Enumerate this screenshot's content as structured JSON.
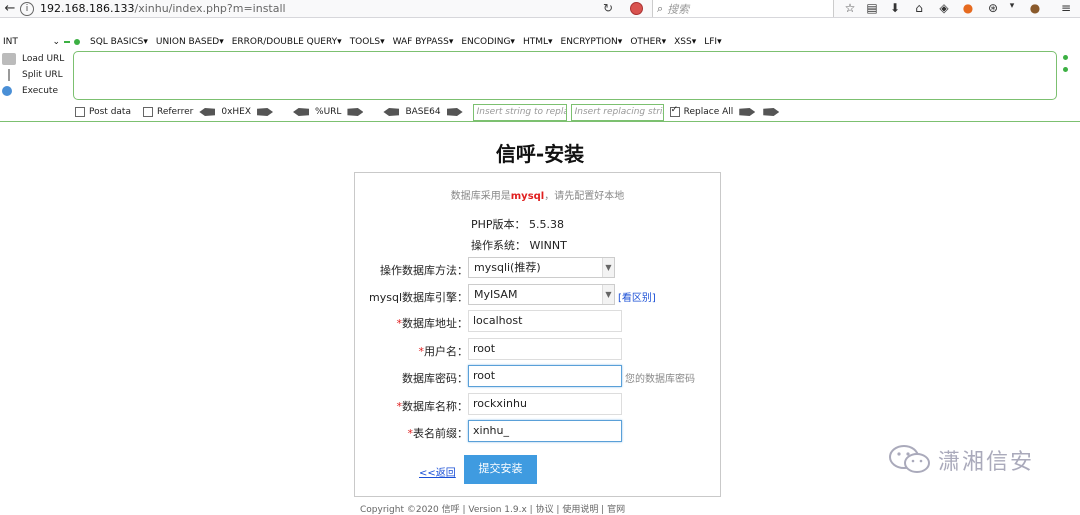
{
  "browser": {
    "url_host": "192.168.186.133",
    "url_path": "/xinhu/index.php?m=install",
    "search_placeholder": "搜索"
  },
  "hackbar": {
    "encoding_select": "INT",
    "menus": [
      "SQL BASICS▾",
      "UNION BASED▾",
      "ERROR/DOUBLE QUERY▾",
      "TOOLS▾",
      "WAF BYPASS▾",
      "ENCODING▾",
      "HTML▾",
      "ENCRYPTION▾",
      "OTHER▾",
      "XSS▾",
      "LFI▾"
    ],
    "load_url": "Load URL",
    "split_url": "Split URL",
    "execute": "Execute",
    "post_data": "Post data",
    "referrer": "Referrer",
    "hex": "0xHEX",
    "url_enc": "%URL",
    "base64": "BASE64",
    "insert_ph": "Insert string to replace",
    "replacing_ph": "Insert replacing string",
    "replace_all": "Replace All"
  },
  "page": {
    "title": "信呼-安装",
    "notice_pre": "数据库采用是",
    "notice_hl": "mysql",
    "notice_post": "，请先配置好本地",
    "php_version": "PHP版本：  5.5.38",
    "os": "操作系统：  WINNT",
    "db_method_label": "操作数据库方法：",
    "db_method_value": "mysqli(推荐)",
    "engine_label": "mysql数据库引擎：",
    "engine_value": "MyISAM",
    "engine_link": "[看区别]",
    "host_label": "数据库地址：",
    "host_value": "localhost",
    "user_label": "用户名：",
    "user_value": "root",
    "pass_label": "数据库密码：",
    "pass_value": "root",
    "pass_hint": "您的数据库密码",
    "dbname_label": "数据库名称：",
    "dbname_value": "rockxinhu",
    "prefix_label": "表名前缀：",
    "prefix_value": "xinhu_",
    "required_mark": "*",
    "back_link": "<<返回",
    "submit": "提交安装",
    "footer": "Copyright ©2020 信呼 | Version 1.9.x | 协议 | 使用说明 | 官网"
  },
  "watermark": {
    "text": "潇湘信安"
  }
}
